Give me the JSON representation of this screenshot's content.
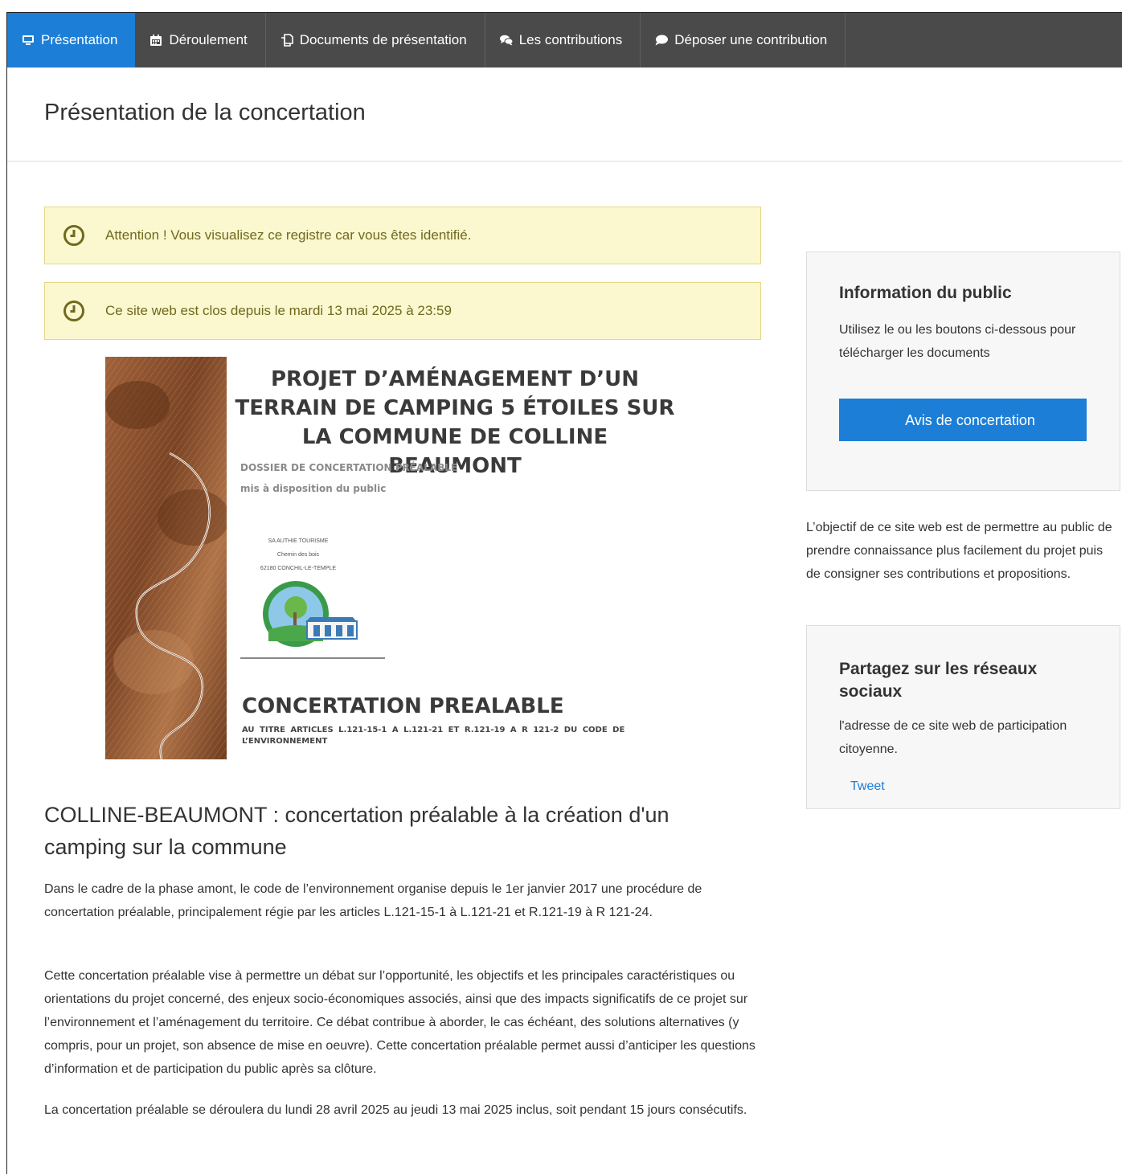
{
  "nav": {
    "tabs": [
      {
        "label": "Présentation",
        "icon": "monitor-icon"
      },
      {
        "label": "Déroulement",
        "icon": "calendar-icon"
      },
      {
        "label": "Documents de présentation",
        "icon": "copy-icon"
      },
      {
        "label": "Les contributions",
        "icon": "comments-icon"
      },
      {
        "label": "Déposer une contribution",
        "icon": "comment-icon"
      }
    ]
  },
  "header": {
    "title": "Présentation de la concertation"
  },
  "alerts": [
    "Attention ! Vous visualisez ce registre car vous êtes identifié.",
    "Ce site web est clos depuis le mardi 13 mai 2025 à 23:59"
  ],
  "cover": {
    "title_lines": [
      "PROJET D’AMÉNAGEMENT D’UN",
      "TERRAIN DE CAMPING 5 ÉTOILES SUR",
      "LA COMMUNE DE COLLINE BEAUMONT"
    ],
    "subtitle1": "DOSSIER DE CONCERTATION PRÉALABLE",
    "subtitle2": "mis à disposition du public",
    "address": [
      "SA AUTHIE TOURISME",
      "Chemin des bois",
      "62180 CONCHIL-LE-TEMPLE"
    ],
    "big_title": "CONCERTATION PREALABLE",
    "small_text": "AU TITRE ARTICLES L.121-15-1 A L.121-21 ET R.121-19 A R 121-2 DU CODE DE L’ENVIRONNEMENT"
  },
  "main": {
    "heading": "COLLINE-BEAUMONT : concertation préalable à la création d'un camping sur la commune",
    "paragraphs": [
      "Dans le cadre de la phase amont, le code de l’environnement organise depuis le 1er janvier 2017 une procédure de concertation préalable, principalement régie par les articles L.121-15-1 à L.121-21 et R.121-19 à R 121-24.",
      "Cette concertation préalable vise à permettre un débat sur l’opportunité, les objectifs et les principales caractéristiques ou orientations du projet concerné, des enjeux socio-économiques associés, ainsi que des impacts significatifs de ce projet sur l’environnement et l’aménagement du territoire. Ce débat contribue à aborder, le cas échéant, des solutions alternatives (y compris, pour un projet, son absence de mise en oeuvre). Cette concertation préalable permet aussi d’anticiper les questions d’information et de participation du public après sa clôture.",
      "La concertation préalable se déroulera du lundi 28 avril 2025 au jeudi 13 mai 2025 inclus, soit pendant 15 jours consécutifs."
    ]
  },
  "sidebar": {
    "info_title": "Information du public",
    "info_text": "Utilisez le ou les boutons ci-dessous pour télécharger les documents",
    "button_label": "Avis de concertation",
    "objective_text": "L’objectif de ce site web est de permettre au public de prendre connaissance plus facilement du projet puis de consigner ses contributions et propositions.",
    "share_title": "Partagez sur les réseaux sociaux",
    "share_text": "l'adresse de ce site web de participation citoyenne.",
    "tweet_label": "Tweet"
  },
  "colors": {
    "accent": "#1c7ed6",
    "nav_bg": "#4a4a4a",
    "alert_bg": "#fbf7cf",
    "alert_text": "#6f6a1d"
  }
}
